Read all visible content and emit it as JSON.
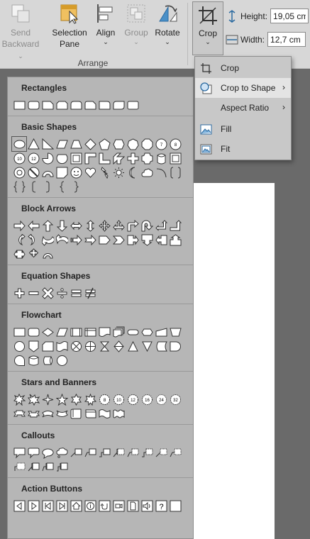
{
  "ribbon": {
    "send_backward": {
      "label_line1": "Send",
      "label_line2": "Backward",
      "icon": "send-backward-icon",
      "disabled": true
    },
    "selection_pane": {
      "label_line1": "Selection",
      "label_line2": "Pane",
      "icon": "selection-pane-icon"
    },
    "align": {
      "label": "Align",
      "icon": "align-icon"
    },
    "group": {
      "label": "Group",
      "icon": "group-icon",
      "disabled": true
    },
    "rotate": {
      "label": "Rotate",
      "icon": "rotate-icon"
    },
    "group_label": "Arrange",
    "crop": {
      "label": "Crop",
      "icon": "crop-icon"
    },
    "height": {
      "label": "Height:",
      "value": "19,05 cm"
    },
    "width": {
      "label": "Width:",
      "value": "12,7 cm"
    }
  },
  "crop_menu": {
    "items": [
      {
        "label": "Crop",
        "icon": "crop-icon",
        "has_submenu": false
      },
      {
        "label": "Crop to Shape",
        "icon": "crop-to-shape-icon",
        "has_submenu": true,
        "highlighted": true
      },
      {
        "label": "Aspect Ratio",
        "icon": "",
        "has_submenu": true
      },
      {
        "label": "Fill",
        "icon": "fill-icon",
        "has_submenu": false
      },
      {
        "label": "Fit",
        "icon": "fit-icon",
        "has_submenu": false
      }
    ]
  },
  "shape_panel": {
    "sections": [
      {
        "title": "Rectangles",
        "count": 9
      },
      {
        "title": "Basic Shapes",
        "count": 42
      },
      {
        "title": "Block Arrows",
        "count": 27
      },
      {
        "title": "Equation Shapes",
        "count": 6
      },
      {
        "title": "Flowchart",
        "count": 28
      },
      {
        "title": "Stars and Banners",
        "count": 20
      },
      {
        "title": "Callouts",
        "count": 16
      },
      {
        "title": "Action Buttons",
        "count": 12
      }
    ]
  }
}
